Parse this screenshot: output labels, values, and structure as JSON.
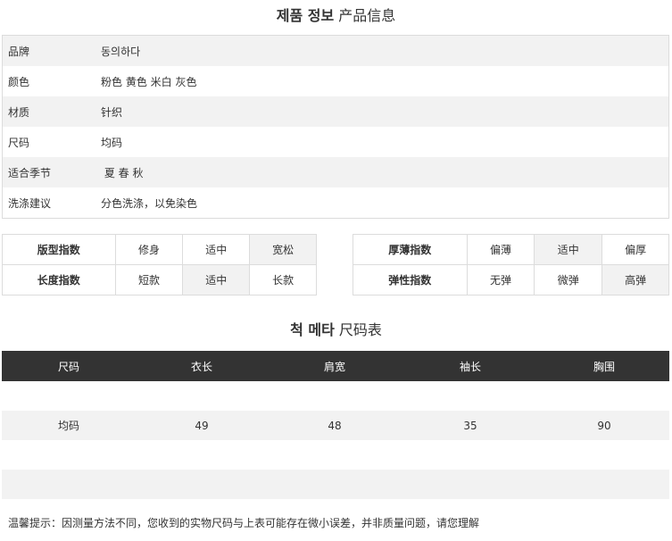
{
  "product_info": {
    "title_ko": "제품 정보",
    "title_zh": "产品信息",
    "rows": [
      {
        "label": "品牌",
        "value": "동의하다"
      },
      {
        "label": "颜色",
        "value": "粉色 黄色 米白 灰色"
      },
      {
        "label": "材质",
        "value": "针织"
      },
      {
        "label": "尺码",
        "value": "均码"
      },
      {
        "label": "适合季节",
        "value": " 夏 春 秋"
      },
      {
        "label": "洗涤建议",
        "value": "分色洗涤，以免染色"
      }
    ]
  },
  "indices": {
    "left": {
      "rows": [
        {
          "label": "版型指数",
          "options": [
            "修身",
            "适中",
            "宽松"
          ],
          "selected": 2
        },
        {
          "label": "长度指数",
          "options": [
            "短款",
            "适中",
            "长款"
          ],
          "selected": 1
        }
      ]
    },
    "right": {
      "rows": [
        {
          "label": "厚薄指数",
          "options": [
            "偏薄",
            "适中",
            "偏厚"
          ],
          "selected": 1
        },
        {
          "label": "弹性指数",
          "options": [
            "无弹",
            "微弹",
            "高弹"
          ],
          "selected": 2
        }
      ]
    }
  },
  "size_chart": {
    "title_ko": "척 메타",
    "title_zh": "尺码表",
    "headers": [
      "尺码",
      "衣长",
      "肩宽",
      "袖长",
      "胸围"
    ],
    "rows": [
      [
        "",
        "",
        "",
        "",
        ""
      ],
      [
        "均码",
        "49",
        "48",
        "35",
        "90"
      ],
      [
        "",
        "",
        "",
        "",
        ""
      ],
      [
        "",
        "",
        "",
        "",
        ""
      ]
    ]
  },
  "note": "温馨提示：因测量方法不同，您收到的实物尺码与上表可能存在微小误差，并非质量问题，请您理解",
  "colors": {
    "header_dark": "#333333",
    "stripe": "#f2f2f2",
    "border": "#dcdcdc"
  }
}
